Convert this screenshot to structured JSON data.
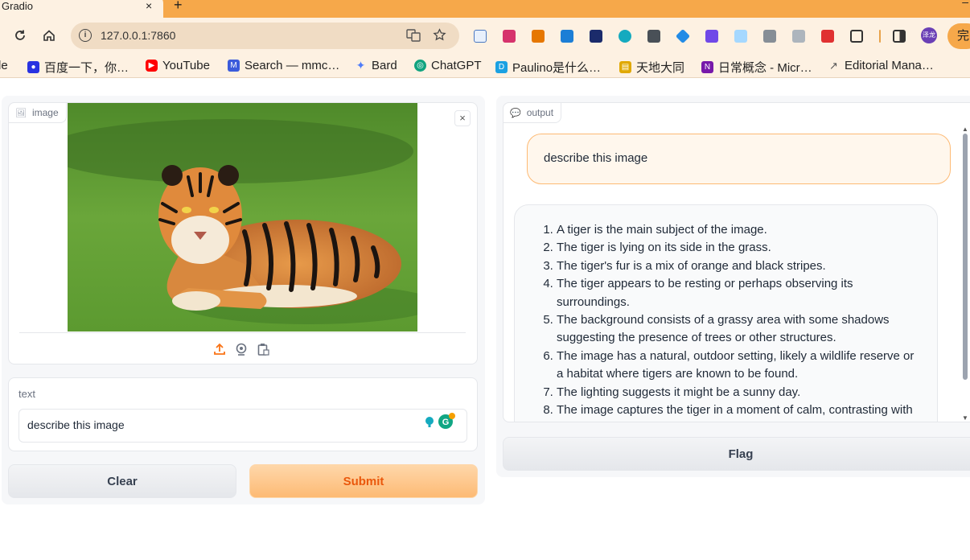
{
  "browser": {
    "tab_title": "Gradio",
    "tab_close": "×",
    "new_tab": "+",
    "minimize": "–",
    "url": "127.0.0.1:7860",
    "update_label": "完",
    "profile_label": "泽龙"
  },
  "bookmarks": [
    {
      "label": "le",
      "color": "#4285f4"
    },
    {
      "label": "百度一下，你…",
      "color": "#2932e1"
    },
    {
      "label": "YouTube",
      "color": "#ff0000"
    },
    {
      "label": "Search — mmc…",
      "color": "#3b5bdb"
    },
    {
      "label": "Bard",
      "color": "#4f7df9"
    },
    {
      "label": "ChatGPT",
      "color": "#10a37f"
    },
    {
      "label": "Paulino是什么…",
      "color": "#1ba1e2"
    },
    {
      "label": "天地大同",
      "color": "#e0a800"
    },
    {
      "label": "日常概念 - Micr…",
      "color": "#7719aa"
    },
    {
      "label": "Editorial Mana…",
      "color": "#555555"
    }
  ],
  "input_panel": {
    "image_label": "image",
    "image_close": "×",
    "text_label": "text",
    "text_value": "describe this image",
    "clear_label": "Clear",
    "submit_label": "Submit"
  },
  "output_panel": {
    "label": "output",
    "user_message": "describe this image",
    "bot_items": [
      "A tiger is the main subject of the image.",
      "The tiger is lying on its side in the grass.",
      "The tiger's fur is a mix of orange and black stripes.",
      "The tiger appears to be resting or perhaps observing its surroundings.",
      "The background consists of a grassy area with some shadows suggesting the presence of trees or other structures.",
      "The image has a natural, outdoor setting, likely a wildlife reserve or a habitat where tigers are known to be found.",
      "The lighting suggests it might be a sunny day.",
      "The image captures the tiger in a moment of calm, contrasting with its usual image as a powerful predator."
    ],
    "flag_label": "Flag"
  },
  "colors": {
    "accent": "#f97316",
    "primary_button_text": "#ea580c",
    "chrome": "#fdf1e2"
  }
}
